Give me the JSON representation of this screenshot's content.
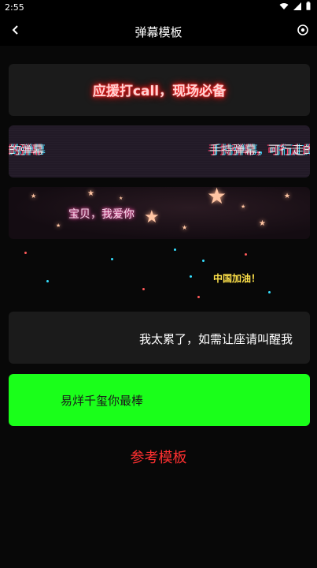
{
  "status_bar": {
    "time": "2:55"
  },
  "app_bar": {
    "title": "弹幕模板"
  },
  "templates": {
    "neon_red": "应援打call，现场必备",
    "glitch_left": "的弹幕",
    "glitch_right": "手持弹幕，可行走的",
    "stars": "宝贝，我爱你",
    "china": "中国加油！",
    "seat": "我太累了，如需让座请叫醒我",
    "green": "易烊千玺你最棒"
  },
  "reference_label": "参考模板",
  "colors": {
    "background": "#000000",
    "neon_red": "#ff2020",
    "green_card": "#1aff1a",
    "reference_text": "#ff3030",
    "china_text": "#ffe24a"
  }
}
